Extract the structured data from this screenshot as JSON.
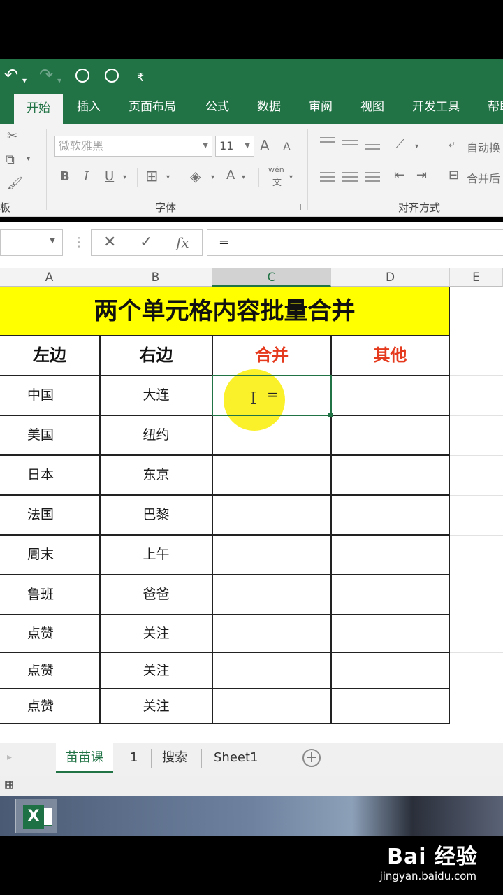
{
  "quick_access": {
    "undo_icon": "undo-icon",
    "redo_icon": "redo-icon",
    "dropdown_glyph": "▾",
    "customize_glyph": "₹"
  },
  "tabs": [
    "开始",
    "插入",
    "页面布局",
    "公式",
    "数据",
    "审阅",
    "视图",
    "开发工具",
    "帮助"
  ],
  "ribbon": {
    "font_name": "微软雅黑",
    "font_size": "11",
    "grow_font": "A",
    "shrink_font": "A",
    "bold": "B",
    "italic": "I",
    "underline": "U",
    "font_color": "A",
    "phonetic": "wén",
    "phonetic_sub": "文",
    "wrap_text": "自动换",
    "merge_center": "合并后",
    "clipboard_label": "板",
    "font_group_label": "字体",
    "align_group_label": "对齐方式"
  },
  "formula_bar": {
    "cancel": "✕",
    "enter": "✓",
    "fx": "fx",
    "value": "="
  },
  "columns": [
    "A",
    "B",
    "C",
    "D",
    "E"
  ],
  "table": {
    "title": "两个单元格内容批量合并",
    "headers": [
      "左边",
      "右边",
      "合并",
      "其他"
    ],
    "rows": [
      [
        "中国",
        "大连"
      ],
      [
        "美国",
        "纽约"
      ],
      [
        "日本",
        "东京"
      ],
      [
        "法国",
        "巴黎"
      ],
      [
        "周末",
        "上午"
      ],
      [
        "鲁班",
        "爸爸"
      ],
      [
        "点赞",
        "关注"
      ],
      [
        "点赞",
        "关注"
      ],
      [
        "点赞",
        "关注"
      ]
    ],
    "active_cell_text": "="
  },
  "sheets": [
    "苗苗课",
    "1",
    "搜索",
    "Sheet1"
  ],
  "add_sheet": "+",
  "colors": {
    "excel_green": "#217346",
    "title_fill": "#ffff00",
    "header_red": "#e53a1e"
  },
  "watermark": {
    "brand": "Bai 经验",
    "url": "jingyan.baidu.com"
  }
}
